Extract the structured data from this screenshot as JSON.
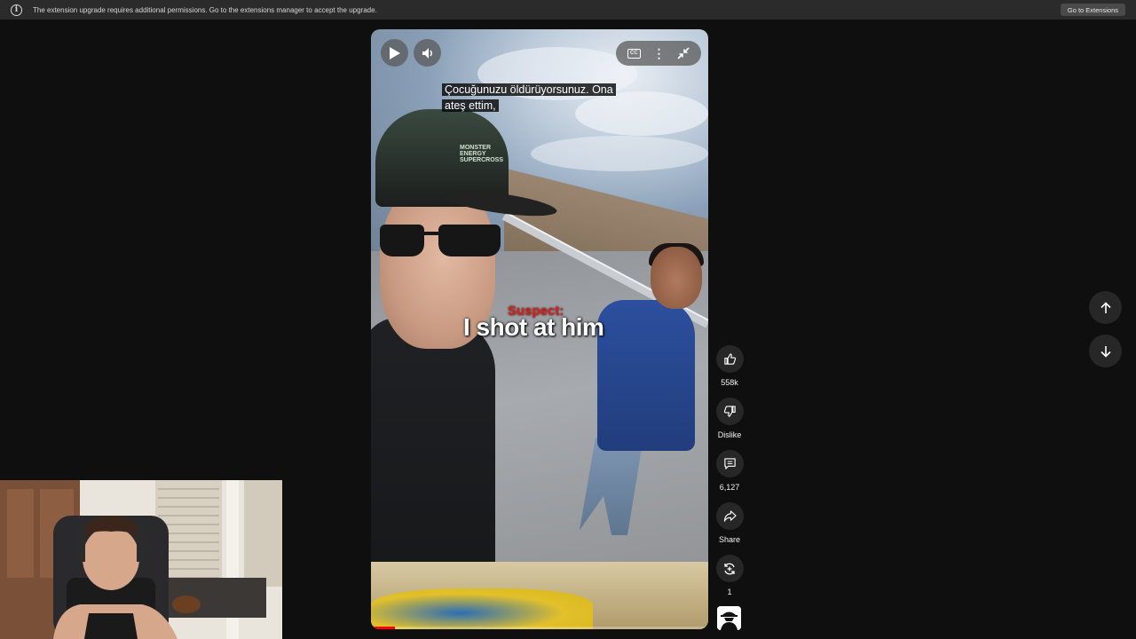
{
  "notification": {
    "text": "The extension upgrade requires additional permissions. Go to the extensions manager to accept the upgrade.",
    "button": "Go to Extensions"
  },
  "video": {
    "subtitle_line1": "Çocuğunuzu öldürüyorsunuz.   Ona",
    "subtitle_line2": "ateş ettim,",
    "burned_label": "Suspect:",
    "burned_caption": "I shot at him",
    "cap_text": "MONSTER ENERGY SUPERCROSS",
    "controls": {
      "play_icon": "play-icon",
      "volume_icon": "volume-icon",
      "cc_label": "CC",
      "more_icon": "more-vert-icon",
      "collapse_icon": "collapse-icon"
    },
    "progress_fraction": 0.07
  },
  "actions": {
    "like_count": "558k",
    "dislike_label": "Dislike",
    "comment_count": "6,127",
    "share_label": "Share",
    "remix_count": "1"
  },
  "colors": {
    "background": "#0f0f0f",
    "button_bg": "#272727",
    "accent_red": "#ff0000",
    "notification_bg": "#2b2b2b"
  }
}
